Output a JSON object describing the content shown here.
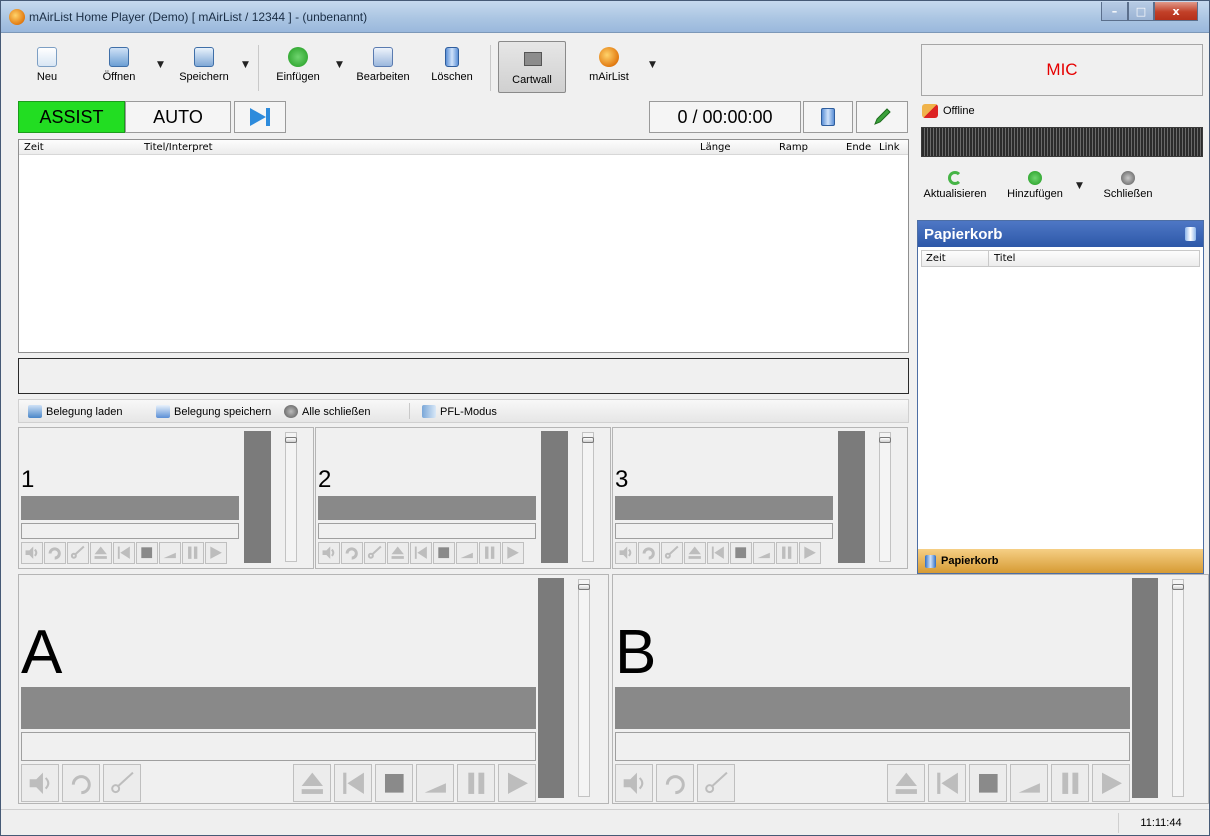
{
  "window": {
    "title": "mAirList Home Player (Demo) [ mAirList / 12344 ] - (unbenannt)",
    "buttons": [
      "–",
      "□",
      "x"
    ]
  },
  "toolbar": {
    "new": "Neu",
    "open": "Öffnen",
    "save": "Speichern",
    "insert": "Einfügen",
    "edit": "Bearbeiten",
    "delete": "Löschen",
    "cartwall": "Cartwall",
    "mairlist": "mAirList"
  },
  "mode": {
    "assist": "ASSIST",
    "auto": "AUTO",
    "time": "0 / 00:00:00"
  },
  "playlist": {
    "columns": [
      "Zeit",
      "Titel/Interpret",
      "Länge",
      "Ramp",
      "Ende",
      "Link"
    ]
  },
  "cartwall": {
    "load": "Belegung laden",
    "save": "Belegung speichern",
    "close_all": "Alle schließen",
    "pfl": "PFL-Modus",
    "slots": [
      "1",
      "2",
      "3"
    ]
  },
  "players": [
    "A",
    "B"
  ],
  "mic": "MIC",
  "encoder": {
    "status": "Offline",
    "refresh": "Aktualisieren",
    "add": "Hinzufügen",
    "close": "Schließen"
  },
  "trash": {
    "title": "Papierkorb",
    "columns": [
      "Zeit",
      "Titel"
    ],
    "footer": "Papierkorb"
  },
  "status": {
    "clock": "11:11:44"
  },
  "colors": {
    "assist": "#22dd22",
    "mic": "#e60000",
    "panel_header": "#3765b8",
    "trash_footer": "#e6ad4d"
  }
}
